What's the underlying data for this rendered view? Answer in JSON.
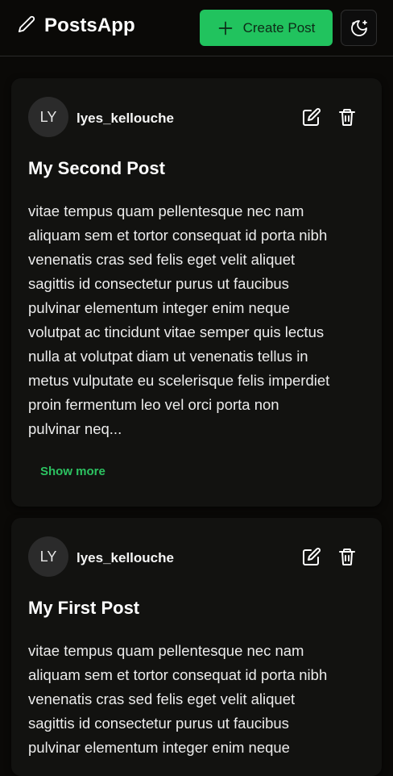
{
  "header": {
    "brand_icon": "pencil-icon",
    "title": "PostsApp",
    "create_button": {
      "icon": "plus-icon",
      "label": "Create Post"
    },
    "theme_toggle": {
      "icon": "moon-stars-icon"
    }
  },
  "colors": {
    "background": "#0a0907",
    "card": "#121210",
    "accent": "#21c35e",
    "link": "#2cc261"
  },
  "posts": [
    {
      "avatar_initials": "LY",
      "username": "lyes_kellouche",
      "edit_icon": "edit-icon",
      "delete_icon": "trash-icon",
      "title": "My Second Post",
      "body": "vitae tempus quam pellentesque nec nam\naliquam sem et tortor consequat id porta nibh\nvenenatis cras sed felis eget velit aliquet\nsagittis id consectetur purus ut faucibus\npulvinar elementum integer enim neque\nvolutpat ac tincidunt vitae semper quis lectus\nnulla at volutpat diam ut venenatis tellus in\nmetus vulputate eu scelerisque felis imperdiet\nproin fermentum leo vel orci porta non\npulvinar neq...",
      "show_more": "Show more"
    },
    {
      "avatar_initials": "LY",
      "username": "lyes_kellouche",
      "edit_icon": "edit-icon",
      "delete_icon": "trash-icon",
      "title": "My First Post",
      "body": "vitae tempus quam pellentesque nec nam\naliquam sem et tortor consequat id porta nibh\nvenenatis cras sed felis eget velit aliquet\nsagittis id consectetur purus ut faucibus\npulvinar elementum integer enim neque"
    }
  ]
}
